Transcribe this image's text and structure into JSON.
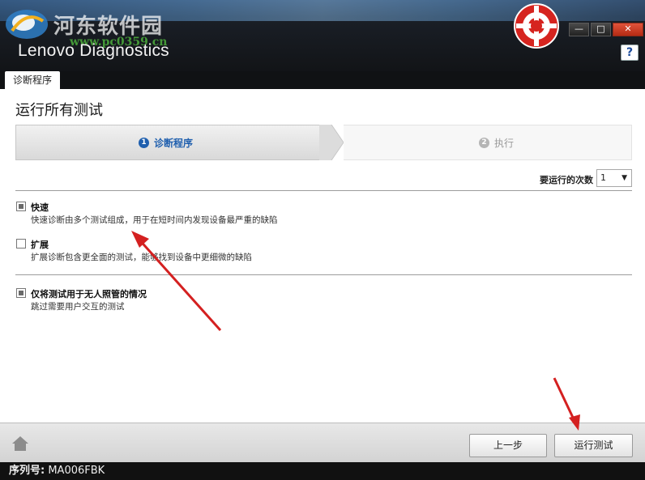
{
  "window": {
    "watermark_text": "河东软件园",
    "watermark_url": "www.pc0359.cn",
    "app_title": "Lenovo Diagnostics",
    "minimize_glyph": "—",
    "maximize_glyph": "□",
    "close_glyph": "✕",
    "help_glyph": "?"
  },
  "tabs": [
    {
      "label": "诊断程序",
      "active": true
    }
  ],
  "main": {
    "title": "运行所有测试",
    "wizard": {
      "steps": [
        {
          "number": "1",
          "label": "诊断程序",
          "active": true
        },
        {
          "number": "2",
          "label": "执行",
          "active": false
        }
      ]
    },
    "runs": {
      "label": "要运行的次数",
      "value": "1"
    },
    "options": [
      {
        "title": "快速",
        "description": "快速诊断由多个测试组成，用于在短时间内发现设备最严重的缺陷",
        "checked": true
      },
      {
        "title": "扩展",
        "description": "扩展诊断包含更全面的测试，能够找到设备中更细微的缺陷",
        "checked": false
      },
      {
        "title": "仅将测试用于无人照管的情况",
        "description": "跳过需要用户交互的测试",
        "checked": true
      }
    ]
  },
  "footer": {
    "prev_label": "上一步",
    "run_label": "运行测试"
  },
  "status": {
    "serial_label": "序列号:",
    "serial_value": "MA006FBK"
  },
  "colors": {
    "accent": "#1f5fae",
    "close_button": "#c9391f",
    "annotation_arrow": "#d42020",
    "titlebar": "#121417"
  }
}
